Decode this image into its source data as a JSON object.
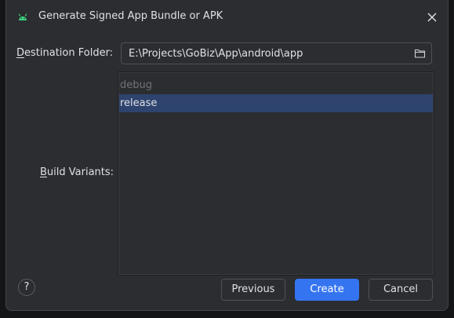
{
  "dialog": {
    "title": "Generate Signed App Bundle or APK",
    "title_icon": "android-icon",
    "close_icon": "close-icon"
  },
  "destination": {
    "label_mnemonic": "D",
    "label_rest": "estination Folder:",
    "value": "E:\\Projects\\GoBiz\\App\\android\\app",
    "browse_icon": "folder-icon"
  },
  "build_variants": {
    "label_mnemonic": "B",
    "label_rest": "uild Variants:",
    "items": [
      {
        "label": "debug",
        "selected": false
      },
      {
        "label": "release",
        "selected": true
      }
    ]
  },
  "footer": {
    "help_label": "?",
    "previous_label": "Previous",
    "create_label": "Create",
    "cancel_label": "Cancel"
  },
  "colors": {
    "background": "#2b2d30",
    "selection": "#2e436e",
    "primary_button": "#3574f0",
    "android_green": "#3ddc84"
  }
}
